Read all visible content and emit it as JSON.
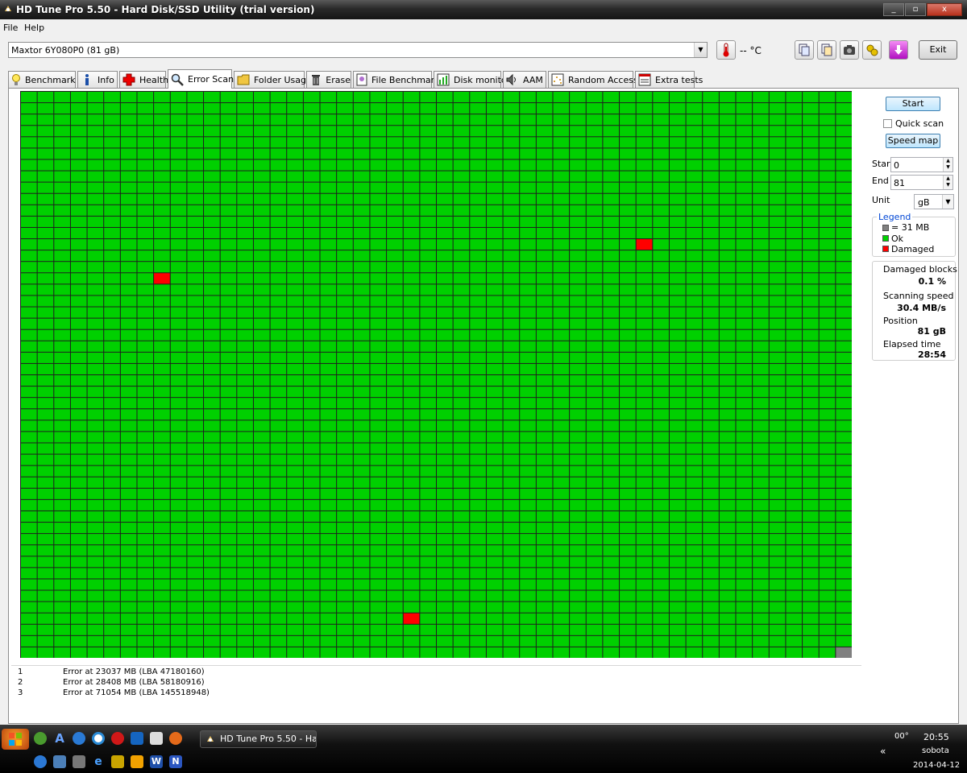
{
  "window": {
    "title": "HD Tune Pro 5.50 - Hard Disk/SSD Utility (trial version)",
    "min": "_",
    "max": "▫",
    "close": "x"
  },
  "menu": [
    "File",
    "Help"
  ],
  "toolbar": {
    "drive": "Maxtor 6Y080P0 (81 gB)",
    "temperature": "-- °C",
    "exit_label": "Exit"
  },
  "tabs": [
    {
      "label": "Benchmark",
      "icon": "lightbulb-icon"
    },
    {
      "label": "Info",
      "icon": "info-icon"
    },
    {
      "label": "Health",
      "icon": "health-cross-icon"
    },
    {
      "label": "Error Scan",
      "icon": "magnifier-icon"
    },
    {
      "label": "Folder Usage",
      "icon": "folder-icon"
    },
    {
      "label": "Erase",
      "icon": "trash-icon"
    },
    {
      "label": "File Benchmark",
      "icon": "file-benchmark-icon"
    },
    {
      "label": "Disk monitor",
      "icon": "disk-monitor-icon"
    },
    {
      "label": "AAM",
      "icon": "speaker-icon"
    },
    {
      "label": "Random Access",
      "icon": "random-access-icon"
    },
    {
      "label": "Extra tests",
      "icon": "extra-tests-icon"
    }
  ],
  "active_tab": "Error Scan",
  "scan_grid": {
    "columns": 50,
    "rows": 50,
    "colors": {
      "ok": "#00d000",
      "damaged": "#ff0000",
      "unscanned": "#808080",
      "border": "#1e1e1e"
    },
    "damaged_blocks": [
      [
        8,
        16
      ],
      [
        37,
        13
      ],
      [
        23,
        46
      ]
    ],
    "unscanned_blocks": [
      [
        49,
        49
      ]
    ]
  },
  "controls": {
    "start_label": "Start",
    "quick_scan_label": "Quick scan",
    "quick_scan_checked": false,
    "speed_map_label": "Speed map",
    "start_field_label": "Start",
    "start_value": "0",
    "end_field_label": "End",
    "end_value": "81",
    "unit_label": "Unit",
    "unit_value": "gB"
  },
  "legend": {
    "title": "Legend",
    "items": [
      {
        "label": "= 31 MB",
        "color": "#808080"
      },
      {
        "label": "Ok",
        "color": "#00d000"
      },
      {
        "label": "Damaged",
        "color": "#ff0000"
      }
    ]
  },
  "stats": {
    "damaged_label": "Damaged blocks",
    "damaged_value": "0.1 %",
    "speed_label": "Scanning speed",
    "speed_value": "30.4 MB/s",
    "position_label": "Position",
    "position_value": "81 gB",
    "elapsed_label": "Elapsed time",
    "elapsed_value": "28:54"
  },
  "errors": [
    {
      "n": "1",
      "text": "Error at 23037 MB (LBA 47180160)"
    },
    {
      "n": "2",
      "text": "Error at 28408 MB (LBA 58180916)"
    },
    {
      "n": "3",
      "text": "Error at 71054 MB (LBA 145518948)"
    }
  ],
  "taskbar": {
    "task_label": "HD Tune Pro 5.50 - Ha...",
    "temp": "00°",
    "time": "20:55",
    "day": "sobota",
    "date": "2014-04-12",
    "chevron": "«"
  }
}
